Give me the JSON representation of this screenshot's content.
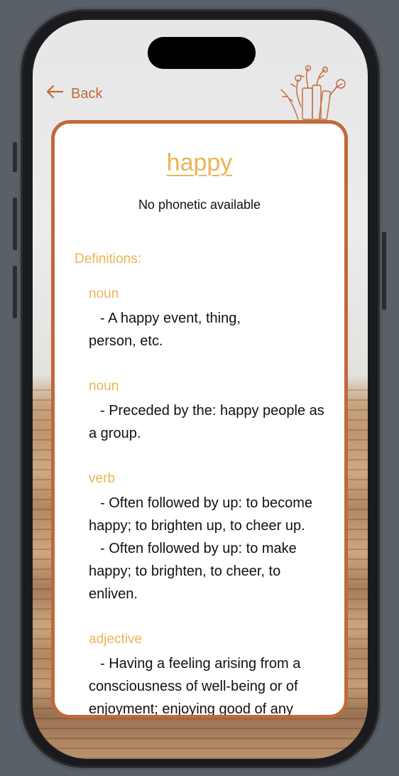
{
  "nav": {
    "back_label": "Back"
  },
  "word": {
    "title": "happy",
    "phonetic": "No phonetic available"
  },
  "definitions_label": "Definitions:",
  "entries": [
    {
      "pos": "noun",
      "meanings": [
        "- A happy event, thing, person, etc."
      ]
    },
    {
      "pos": "noun",
      "meanings": [
        "- Preceded by the: happy people as a group."
      ]
    },
    {
      "pos": "verb",
      "meanings": [
        "- Often followed by up: to become happy; to brighten up, to cheer up.",
        "- Often followed by up: to make happy; to brighten, to cheer, to enliven."
      ]
    },
    {
      "pos": "adjective",
      "meanings": [
        "- Having a feeling arising from a consciousness of well-being or of enjoyment; enjoying good of any"
      ]
    }
  ],
  "colors": {
    "accent_orange": "#c0693a",
    "label_gold": "#eab455"
  },
  "icons": {
    "back": "arrow-left-icon",
    "decoration": "books-flowers-icon"
  }
}
